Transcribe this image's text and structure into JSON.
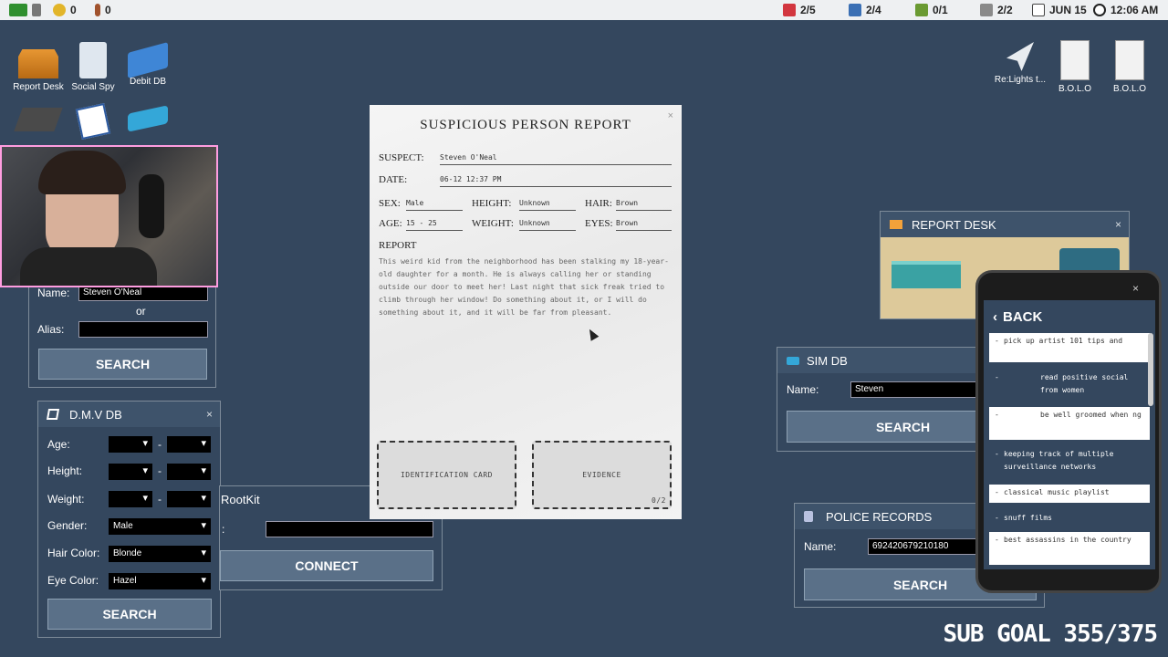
{
  "topbar": {
    "coins": "0",
    "keys": "0",
    "counters": [
      "2/5",
      "2/4",
      "0/1",
      "2/2"
    ],
    "date": "JUN 15",
    "time": "12:06 AM"
  },
  "desktop_icons": {
    "report_desk": "Report Desk",
    "social_spy": "Social Spy",
    "debit_db": "Debit DB",
    "email": "Re:Lights t...",
    "bolo1": "B.O.L.O",
    "bolo2": "B.O.L.O"
  },
  "social_search": {
    "name_label": "Name:",
    "name_value": "Steven O'Neal",
    "or_label": "or",
    "alias_label": "Alias:",
    "search_label": "SEARCH"
  },
  "dmv": {
    "title": "D.M.V DB",
    "age_label": "Age:",
    "height_label": "Height:",
    "weight_label": "Weight:",
    "gender_label": "Gender:",
    "gender_value": "Male",
    "hair_label": "Hair Color:",
    "hair_value": "Blonde",
    "eye_label": "Eye Color:",
    "eye_value": "Hazel",
    "dash": "-",
    "search_label": "SEARCH"
  },
  "rootkit": {
    "title": "RootKit",
    "colon": ":",
    "connect_label": "CONNECT"
  },
  "report": {
    "title": "SUSPICIOUS PERSON REPORT",
    "suspect_label": "SUSPECT:",
    "suspect_value": "Steven O'Neal",
    "date_label": "DATE:",
    "date_value": "06-12 12:37 PM",
    "sex_label": "SEX:",
    "sex_value": "Male",
    "height_label": "HEIGHT:",
    "height_value": "Unknown",
    "hair_label": "HAIR:",
    "hair_value": "Brown",
    "age_label": "AGE:",
    "age_value": "15 - 25",
    "weight_label": "WEIGHT:",
    "weight_value": "Unknown",
    "eyes_label": "EYES:",
    "eyes_value": "Brown",
    "report_label": "REPORT",
    "report_text": "This weird kid from the neighborhood has been stalking my 18-year-old daughter for a month. He is always calling her or standing outside our door to meet her! Last night that sick freak tried to climb through her window! Do something about it, or I will do something about it, and it will be far from pleasant.",
    "id_card_label": "IDENTIFICATION CARD",
    "evidence_label": "EVIDENCE",
    "evidence_count": "0/2"
  },
  "report_desk": {
    "title": "REPORT DESK"
  },
  "sim_db": {
    "title": "SIM DB",
    "name_label": "Name:",
    "name_value": "Steven",
    "search_label": "SEARCH"
  },
  "police": {
    "title": "POLICE RECORDS",
    "name_label": "Name:",
    "name_value": "692420679210180",
    "search_label": "SEARCH"
  },
  "phone": {
    "back_label": "BACK",
    "items": [
      "pick up artist 101 tips and",
      "read positive social from women",
      "be well groomed when ng",
      "keeping track of multiple surveillance networks",
      "classical music playlist",
      "snuff films",
      "best assassins in the country"
    ]
  },
  "overlay": {
    "sub_goal": "SUB GOAL 355/375"
  },
  "close_glyph": "×"
}
